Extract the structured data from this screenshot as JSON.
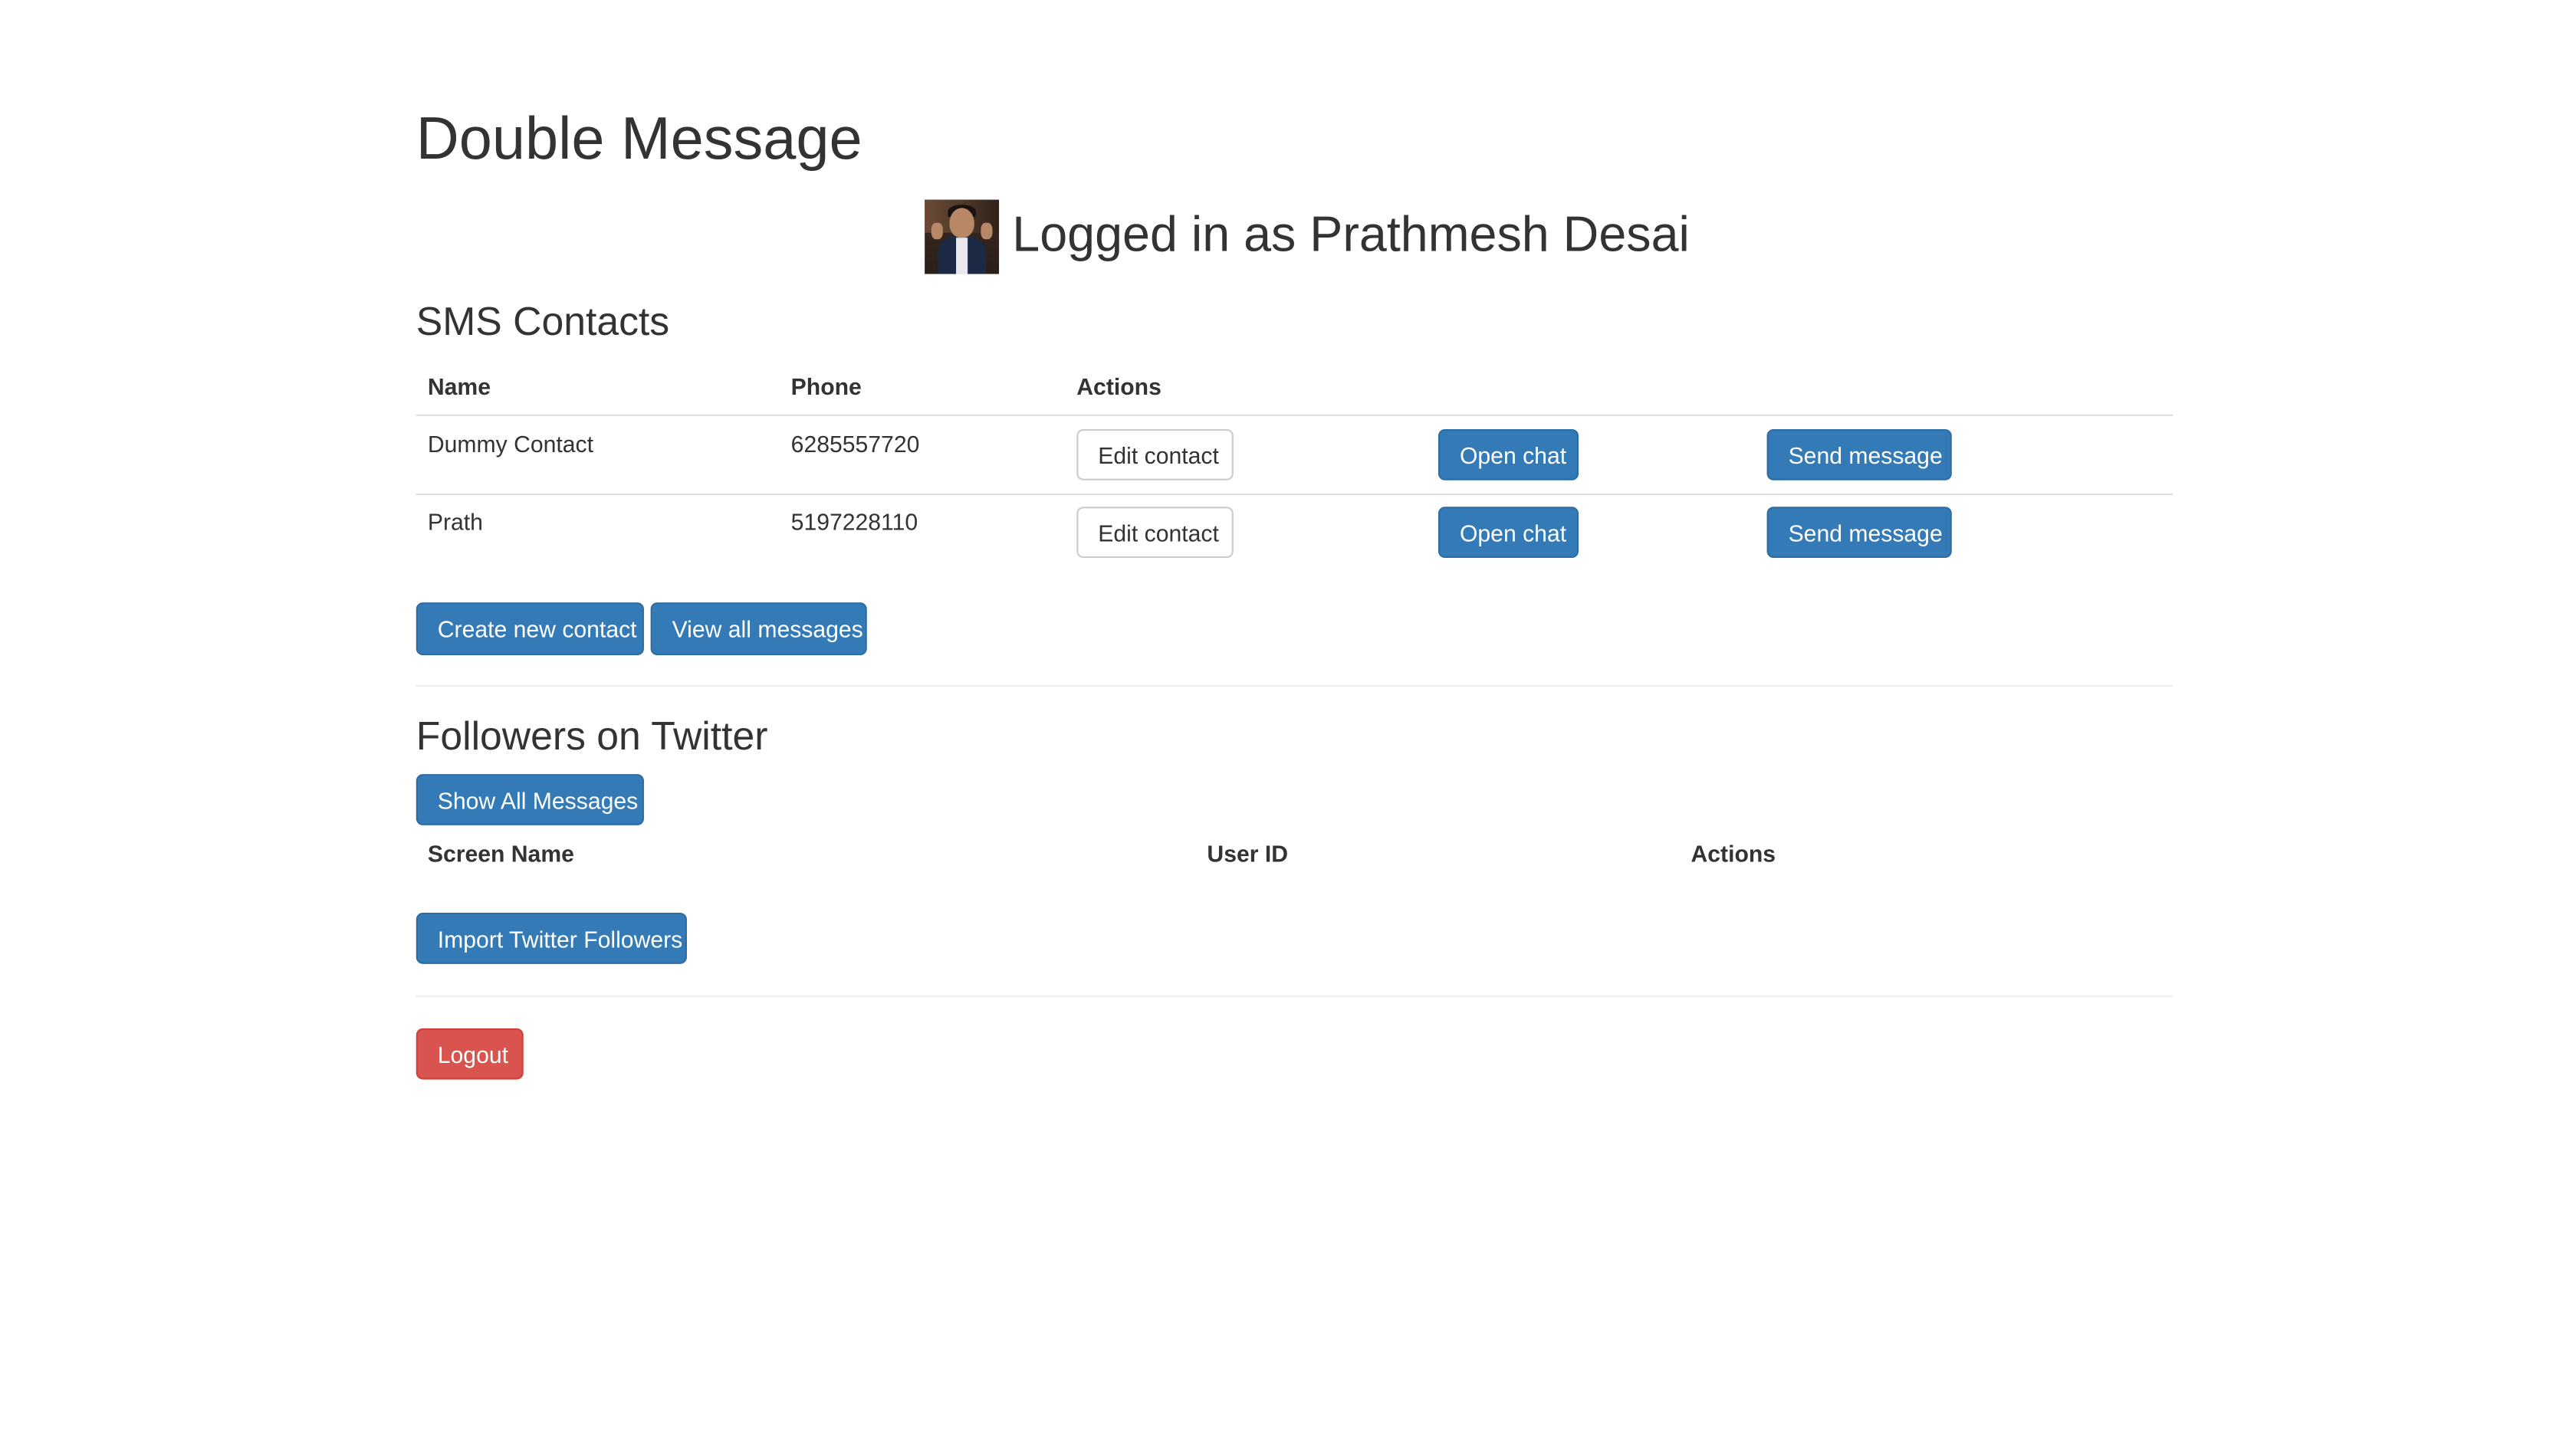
{
  "app": {
    "title": "Double Message"
  },
  "user": {
    "login_text": "Logged in as Prathmesh Desai"
  },
  "sms_section": {
    "title": "SMS Contacts",
    "columns": [
      "Name",
      "Phone",
      "Actions"
    ],
    "rows": [
      {
        "name": "Dummy Contact",
        "phone": "6285557720",
        "edit_label": "Edit contact",
        "chat_label": "Open chat",
        "send_label": "Send message"
      },
      {
        "name": "Prath",
        "phone": "5197228110",
        "edit_label": "Edit contact",
        "chat_label": "Open chat",
        "send_label": "Send message"
      }
    ],
    "create_label": "Create new contact",
    "view_all_label": "View all messages"
  },
  "twitter_section": {
    "title": "Followers on Twitter",
    "show_all_label": "Show All Messages",
    "columns": [
      "Screen Name",
      "User ID",
      "Actions"
    ],
    "import_label": "Import Twitter Followers"
  },
  "footer": {
    "logout_label": "Logout"
  },
  "colors": {
    "primary": "#337ab7",
    "danger": "#d9534f",
    "text": "#333333",
    "border": "#dddddd"
  }
}
